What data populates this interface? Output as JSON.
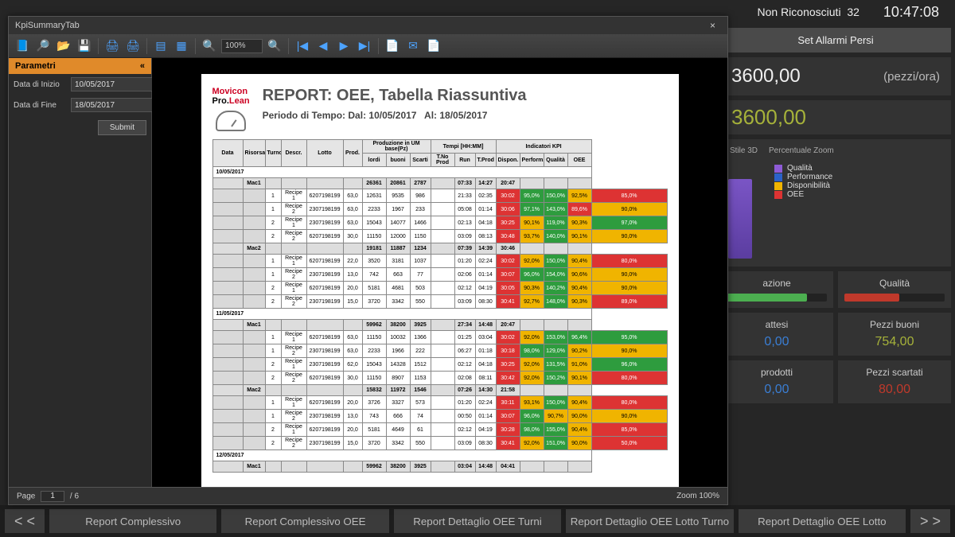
{
  "status": {
    "non_riconosciuti_label": "Non Riconosciuti",
    "non_riconosciuti_count": "32",
    "clock": "10:47:08"
  },
  "dash": {
    "set_allarmi": "Set Allarmi Persi",
    "big_value": "3600,00",
    "big_unit": "(pezzi/ora)",
    "big_value2": "3600,00",
    "tabs": {
      "stile3d": "Stile 3D",
      "zoom": "Percentuale Zoom"
    },
    "legend": {
      "qualita": "Qualità",
      "performance": "Performance",
      "disponibilita": "Disponibilità",
      "oee": "OEE"
    },
    "cards": {
      "azione": "azione",
      "qualita": "Qualità",
      "attesi": "attesi",
      "attesi_val": "0,00",
      "pezzi_buoni": "Pezzi buoni",
      "pezzi_buoni_val": "754,00",
      "prodotti": "prodotti",
      "prodotti_val": "0,00",
      "scartati": "Pezzi scartati",
      "scartati_val": "80,00"
    }
  },
  "bottom": {
    "prev": "< <",
    "next": "> >",
    "b1": "Report Complessivo",
    "b2": "Report Complessivo OEE",
    "b3": "Report Dettaglio OEE Turni",
    "b4": "Report Dettaglio OEE Lotto Turno",
    "b5": "Report Dettaglio OEE Lotto"
  },
  "viewer": {
    "title": "KpiSummaryTab",
    "zoom_combo": "100%",
    "params": {
      "head": "Parametri",
      "data_inizio_lbl": "Data di Inizio",
      "data_inizio": "10/05/2017",
      "data_fine_lbl": "Data di Fine",
      "data_fine": "18/05/2017",
      "submit": "Submit"
    },
    "foot": {
      "page_lbl": "Page",
      "page_cur": "1",
      "page_tot": "/ 6",
      "zoom_lbl": "Zoom",
      "zoom_val": "100%"
    }
  },
  "report": {
    "logo_l1": "Movicon",
    "logo_l2a": "Pro.",
    "logo_l2b": "Lean",
    "title": "REPORT: OEE, Tabella Riassuntiva",
    "period_label": "Periodo di Tempo:",
    "period_from_lbl": "Dal:",
    "period_from": "10/05/2017",
    "period_to_lbl": "Al:",
    "period_to": "18/05/2017",
    "group_headers": {
      "prod": "Produzione in UM base(Pz)",
      "tempi": "Tempi [HH:MM]",
      "kpi": "Indicatori KPI"
    },
    "cols": [
      "Data",
      "Risorsa",
      "Turno",
      "Descr.",
      "Lotto",
      "Prod.",
      "lordi",
      "buoni",
      "Scarti",
      "T.No Prod",
      "Run",
      "T.Prod",
      "Dispon.",
      "Perform.",
      "Qualità",
      "OEE"
    ],
    "dates": {
      "d1": "10/05/2017",
      "d2": "11/05/2017",
      "d3": "12/05/2017"
    },
    "mac1": "Mac1",
    "mac2": "Mac2",
    "rows_d1_mac1_sum": [
      "",
      "",
      "",
      "",
      "",
      "",
      "26361",
      "20861",
      "2787",
      "",
      "07:33",
      "14:27",
      "20:47",
      "",
      "",
      "",
      ""
    ],
    "rows_d1_mac1": [
      [
        "",
        "",
        "1",
        "Recipe 1",
        "6207198199",
        "63,0",
        "12631",
        "9535",
        "986",
        "",
        "21:33",
        "02:35",
        "30:02",
        "95,0%",
        "150,0%",
        "92,5%",
        "85,0%"
      ],
      [
        "",
        "",
        "1",
        "Recipe 2",
        "2307198199",
        "63,0",
        "2233",
        "1967",
        "233",
        "",
        "05:08",
        "01:14",
        "30:06",
        "97,1%",
        "143,0%",
        "89,6%",
        "90,0%"
      ],
      [
        "",
        "",
        "2",
        "Recipe 1",
        "2307198199",
        "63,0",
        "15043",
        "14077",
        "1466",
        "",
        "02:13",
        "04:18",
        "30:25",
        "90,1%",
        "119,0%",
        "90,3%",
        "97,0%"
      ],
      [
        "",
        "",
        "2",
        "Recipe 2",
        "6207198199",
        "30,0",
        "11150",
        "12000",
        "1150",
        "",
        "03:09",
        "08:13",
        "30:48",
        "93,7%",
        "140,0%",
        "90,1%",
        "90,0%"
      ]
    ],
    "rows_d1_mac2_sum": [
      "",
      "",
      "",
      "",
      "",
      "",
      "19181",
      "11887",
      "1234",
      "",
      "07:39",
      "14:39",
      "30:46",
      "",
      "",
      "",
      ""
    ],
    "rows_d1_mac2": [
      [
        "",
        "",
        "1",
        "Recipe 1",
        "6207198199",
        "22,0",
        "3520",
        "3181",
        "1037",
        "",
        "01:20",
        "02:24",
        "30:02",
        "92,0%",
        "150,0%",
        "90,4%",
        "80,0%"
      ],
      [
        "",
        "",
        "1",
        "Recipe 2",
        "2307198199",
        "13,0",
        "742",
        "663",
        "77",
        "",
        "02:06",
        "01:14",
        "30:07",
        "96,0%",
        "154,0%",
        "90,6%",
        "90,0%"
      ],
      [
        "",
        "",
        "2",
        "Recipe 1",
        "6207198199",
        "20,0",
        "5181",
        "4681",
        "503",
        "",
        "02:12",
        "04:19",
        "30:05",
        "90,3%",
        "140,2%",
        "90,4%",
        "90,0%"
      ],
      [
        "",
        "",
        "2",
        "Recipe 2",
        "2307198199",
        "15,0",
        "3720",
        "3342",
        "550",
        "",
        "03:09",
        "08:30",
        "30:41",
        "92,7%",
        "148,0%",
        "90,3%",
        "89,0%"
      ]
    ],
    "rows_d2_mac1_sum": [
      "",
      "",
      "",
      "",
      "",
      "",
      "59962",
      "38200",
      "3925",
      "",
      "27:34",
      "14:48",
      "20:47",
      "",
      "",
      "",
      ""
    ],
    "rows_d2_mac1": [
      [
        "",
        "",
        "1",
        "Recipe 1",
        "6207198199",
        "63,0",
        "11150",
        "10032",
        "1366",
        "",
        "01:25",
        "03:04",
        "30:02",
        "92,0%",
        "153,0%",
        "96,4%",
        "95,0%"
      ],
      [
        "",
        "",
        "1",
        "Recipe 2",
        "2307198199",
        "63,0",
        "2233",
        "1966",
        "222",
        "",
        "06:27",
        "01:18",
        "30:18",
        "98,0%",
        "129,0%",
        "90,2%",
        "90,0%"
      ],
      [
        "",
        "",
        "2",
        "Recipe 1",
        "2307198199",
        "62,0",
        "15043",
        "14328",
        "1512",
        "",
        "02:12",
        "04:18",
        "30:25",
        "92,0%",
        "131,5%",
        "91,0%",
        "96,0%"
      ],
      [
        "",
        "",
        "2",
        "Recipe 2",
        "6207198199",
        "30,0",
        "11150",
        "8907",
        "1153",
        "",
        "02:08",
        "08:11",
        "30:42",
        "92,0%",
        "150,2%",
        "90,1%",
        "80,0%"
      ]
    ],
    "rows_d2_mac2_sum": [
      "",
      "",
      "",
      "",
      "",
      "",
      "15832",
      "11972",
      "1546",
      "",
      "07:26",
      "14:30",
      "21:58",
      "",
      "",
      "",
      ""
    ],
    "rows_d2_mac2": [
      [
        "",
        "",
        "1",
        "Recipe 1",
        "6207198199",
        "20,0",
        "3726",
        "3327",
        "573",
        "",
        "01:20",
        "02:24",
        "30:11",
        "93,1%",
        "150,0%",
        "90,4%",
        "80,0%"
      ],
      [
        "",
        "",
        "1",
        "Recipe 2",
        "2307198199",
        "13,0",
        "743",
        "666",
        "74",
        "",
        "00:50",
        "01:14",
        "30:07",
        "96,0%",
        "90,7%",
        "90,0%",
        "90,0%"
      ],
      [
        "",
        "",
        "2",
        "Recipe 1",
        "6207198199",
        "20,0",
        "5181",
        "4649",
        "61",
        "",
        "02:12",
        "04:19",
        "30:28",
        "98,0%",
        "155,0%",
        "90,4%",
        "85,0%"
      ],
      [
        "",
        "",
        "2",
        "Recipe 2",
        "2307198199",
        "15,0",
        "3720",
        "3342",
        "550",
        "",
        "03:09",
        "08:30",
        "30:41",
        "92,0%",
        "151,0%",
        "90,0%",
        "50,0%"
      ]
    ],
    "rows_d3_mac1_sum": [
      "",
      "",
      "",
      "",
      "",
      "",
      "59962",
      "38200",
      "3925",
      "",
      "03:04",
      "14:48",
      "04:41",
      "",
      "",
      "",
      ""
    ]
  },
  "chart_data": {
    "type": "table",
    "title": "REPORT: OEE, Tabella Riassuntiva — 10/05/2017 to 18/05/2017",
    "columns": [
      "Data",
      "Risorsa",
      "Turno",
      "Descr.",
      "Lotto",
      "Prod.",
      "lordi",
      "buoni",
      "Scarti",
      "T.No Prod",
      "Run",
      "T.Prod",
      "Dispon.",
      "Perform.",
      "Qualità",
      "OEE"
    ],
    "note": "KPI cells color-coded green/yellow/red by threshold"
  }
}
